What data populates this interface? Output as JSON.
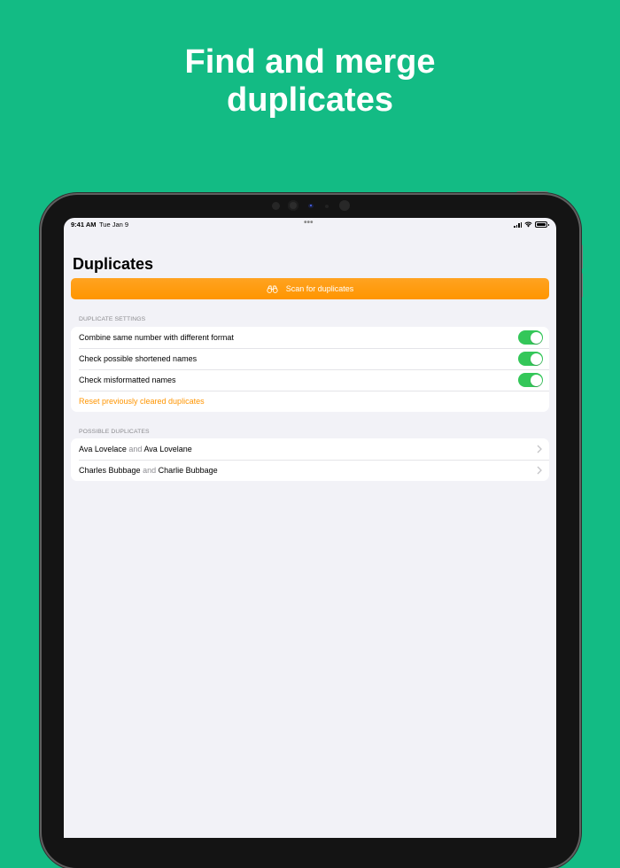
{
  "headline": {
    "line1": "Find and merge",
    "line2": "duplicates"
  },
  "status_bar": {
    "time": "9:41 AM",
    "date": "Tue Jan 9",
    "dots": "•••"
  },
  "page": {
    "title": "Duplicates"
  },
  "scan_button": {
    "label": "Scan for duplicates",
    "icon": "binoculars-icon"
  },
  "settings": {
    "header": "DUPLICATE SETTINGS",
    "rows": [
      {
        "label": "Combine same number with different format",
        "on": true
      },
      {
        "label": "Check possible shortened names",
        "on": true
      },
      {
        "label": "Check misformatted names",
        "on": true
      }
    ],
    "reset_link": "Reset previously cleared duplicates"
  },
  "possible": {
    "header": "POSSIBLE DUPLICATES",
    "pairs": [
      {
        "a": "Ava Lovelace",
        "sep": "and",
        "b": "Ava Lovelane"
      },
      {
        "a": "Charles Bubbage",
        "sep": "and",
        "b": "Charlie Bubbage"
      }
    ]
  },
  "colors": {
    "background": "#13bb84",
    "accent": "#ff9500",
    "toggle_on": "#34c759"
  }
}
